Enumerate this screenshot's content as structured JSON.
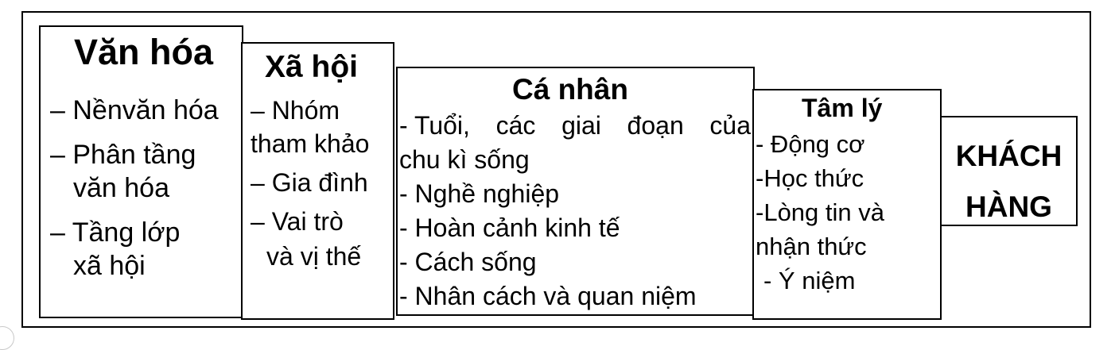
{
  "boxes": {
    "van_hoa": {
      "title": "Văn hóa",
      "lines": [
        "– Nềnvăn hóa",
        "– Phân tầng",
        "văn hóa",
        "– Tầng lớp",
        "xã hội"
      ]
    },
    "xa_hoi": {
      "title": "Xã hội",
      "lines": [
        "– Nhóm",
        "tham khảo",
        "– Gia đình",
        "– Vai trò",
        "và vị thế"
      ]
    },
    "ca_nhan": {
      "title": "Cá nhân",
      "first_line_words": [
        "- Tuổi,",
        "các",
        "giai",
        "đoạn",
        "của"
      ],
      "lines": [
        "chu kì sống",
        "- Nghề nghiệp",
        "- Hoàn cảnh kinh tế",
        "- Cách sống",
        "- Nhân cách và quan niệm"
      ]
    },
    "tam_ly": {
      "title": "Tâm lý",
      "lines": [
        "- Động cơ",
        "-Học thức",
        "-Lòng tin và",
        "nhận thức",
        " - Ý niệm"
      ]
    },
    "khach_hang": {
      "title_lines": [
        "KHÁCH",
        "HÀNG"
      ]
    }
  }
}
